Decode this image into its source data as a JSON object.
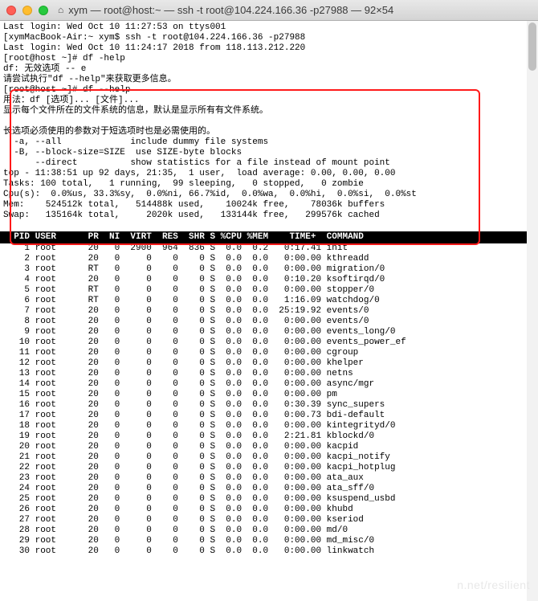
{
  "titlebar": {
    "title": "xym — root@host:~ — ssh -t root@104.224.166.36 -p27988 — 92×54"
  },
  "pre_lines": [
    "Last login: Wed Oct 10 11:27:53 on ttys001",
    "[xymMacBook-Air:~ xym$ ssh -t root@104.224.166.36 -p27988",
    "Last login: Wed Oct 10 11:24:17 2018 from 118.113.212.220",
    "[root@host ~]# df -help",
    "df: 无效选项 -- e",
    "请尝试执行\"df --help\"来获取更多信息。",
    "[root@host ~]# df --help",
    "用法：df [选项]... [文件]...",
    "显示每个文件所在的文件系统的信息，默认是显示所有有文件系统。",
    "",
    "长选项必须使用的参数对于短选项时也是必需使用的。",
    "  -a, --all             include dummy file systems",
    "  -B, --block-size=SIZE  use SIZE-byte blocks",
    "      --direct          show statistics for a file instead of mount point",
    "top - 11:38:51 up 92 days, 21:35,  1 user,  load average: 0.00, 0.00, 0.00",
    "Tasks: 100 total,   1 running,  99 sleeping,   0 stopped,   0 zombie",
    "Cpu(s):  0.0%us, 33.3%sy,  0.0%ni, 66.7%id,  0.0%wa,  0.0%hi,  0.0%si,  0.0%st",
    "Mem:    524512k total,   514488k used,    10024k free,    78036k buffers",
    "Swap:   135164k total,     2020k used,   133144k free,   299576k cached",
    ""
  ],
  "proc_header": "  PID USER      PR  NI  VIRT  RES  SHR S %CPU %MEM    TIME+  COMMAND            ",
  "chart_data": {
    "type": "table",
    "columns": [
      "PID",
      "USER",
      "PR",
      "NI",
      "VIRT",
      "RES",
      "SHR",
      "S",
      "%CPU",
      "%MEM",
      "TIME+",
      "COMMAND"
    ],
    "rows": [
      [
        1,
        "root",
        20,
        0,
        2900,
        964,
        836,
        "S",
        0.0,
        0.2,
        "0:17.41",
        "init"
      ],
      [
        2,
        "root",
        20,
        0,
        0,
        0,
        0,
        "S",
        0.0,
        0.0,
        "0:00.00",
        "kthreadd"
      ],
      [
        3,
        "root",
        "RT",
        0,
        0,
        0,
        0,
        "S",
        0.0,
        0.0,
        "0:00.00",
        "migration/0"
      ],
      [
        4,
        "root",
        20,
        0,
        0,
        0,
        0,
        "S",
        0.0,
        0.0,
        "0:10.20",
        "ksoftirqd/0"
      ],
      [
        5,
        "root",
        "RT",
        0,
        0,
        0,
        0,
        "S",
        0.0,
        0.0,
        "0:00.00",
        "stopper/0"
      ],
      [
        6,
        "root",
        "RT",
        0,
        0,
        0,
        0,
        "S",
        0.0,
        0.0,
        "1:16.09",
        "watchdog/0"
      ],
      [
        7,
        "root",
        20,
        0,
        0,
        0,
        0,
        "S",
        0.0,
        0.0,
        "25:19.92",
        "events/0"
      ],
      [
        8,
        "root",
        20,
        0,
        0,
        0,
        0,
        "S",
        0.0,
        0.0,
        "0:00.00",
        "events/0"
      ],
      [
        9,
        "root",
        20,
        0,
        0,
        0,
        0,
        "S",
        0.0,
        0.0,
        "0:00.00",
        "events_long/0"
      ],
      [
        10,
        "root",
        20,
        0,
        0,
        0,
        0,
        "S",
        0.0,
        0.0,
        "0:00.00",
        "events_power_ef"
      ],
      [
        11,
        "root",
        20,
        0,
        0,
        0,
        0,
        "S",
        0.0,
        0.0,
        "0:00.00",
        "cgroup"
      ],
      [
        12,
        "root",
        20,
        0,
        0,
        0,
        0,
        "S",
        0.0,
        0.0,
        "0:00.00",
        "khelper"
      ],
      [
        13,
        "root",
        20,
        0,
        0,
        0,
        0,
        "S",
        0.0,
        0.0,
        "0:00.00",
        "netns"
      ],
      [
        14,
        "root",
        20,
        0,
        0,
        0,
        0,
        "S",
        0.0,
        0.0,
        "0:00.00",
        "async/mgr"
      ],
      [
        15,
        "root",
        20,
        0,
        0,
        0,
        0,
        "S",
        0.0,
        0.0,
        "0:00.00",
        "pm"
      ],
      [
        16,
        "root",
        20,
        0,
        0,
        0,
        0,
        "S",
        0.0,
        0.0,
        "0:30.39",
        "sync_supers"
      ],
      [
        17,
        "root",
        20,
        0,
        0,
        0,
        0,
        "S",
        0.0,
        0.0,
        "0:00.73",
        "bdi-default"
      ],
      [
        18,
        "root",
        20,
        0,
        0,
        0,
        0,
        "S",
        0.0,
        0.0,
        "0:00.00",
        "kintegrityd/0"
      ],
      [
        19,
        "root",
        20,
        0,
        0,
        0,
        0,
        "S",
        0.0,
        0.0,
        "2:21.81",
        "kblockd/0"
      ],
      [
        20,
        "root",
        20,
        0,
        0,
        0,
        0,
        "S",
        0.0,
        0.0,
        "0:00.00",
        "kacpid"
      ],
      [
        21,
        "root",
        20,
        0,
        0,
        0,
        0,
        "S",
        0.0,
        0.0,
        "0:00.00",
        "kacpi_notify"
      ],
      [
        22,
        "root",
        20,
        0,
        0,
        0,
        0,
        "S",
        0.0,
        0.0,
        "0:00.00",
        "kacpi_hotplug"
      ],
      [
        23,
        "root",
        20,
        0,
        0,
        0,
        0,
        "S",
        0.0,
        0.0,
        "0:00.00",
        "ata_aux"
      ],
      [
        24,
        "root",
        20,
        0,
        0,
        0,
        0,
        "S",
        0.0,
        0.0,
        "0:00.00",
        "ata_sff/0"
      ],
      [
        25,
        "root",
        20,
        0,
        0,
        0,
        0,
        "S",
        0.0,
        0.0,
        "0:00.00",
        "ksuspend_usbd"
      ],
      [
        26,
        "root",
        20,
        0,
        0,
        0,
        0,
        "S",
        0.0,
        0.0,
        "0:00.00",
        "khubd"
      ],
      [
        27,
        "root",
        20,
        0,
        0,
        0,
        0,
        "S",
        0.0,
        0.0,
        "0:00.00",
        "kseriod"
      ],
      [
        28,
        "root",
        20,
        0,
        0,
        0,
        0,
        "S",
        0.0,
        0.0,
        "0:00.00",
        "md/0"
      ],
      [
        29,
        "root",
        20,
        0,
        0,
        0,
        0,
        "S",
        0.0,
        0.0,
        "0:00.00",
        "md_misc/0"
      ],
      [
        30,
        "root",
        20,
        0,
        0,
        0,
        0,
        "S",
        0.0,
        0.0,
        "0:00.00",
        "linkwatch"
      ]
    ]
  },
  "watermark": "n.net/resilient"
}
